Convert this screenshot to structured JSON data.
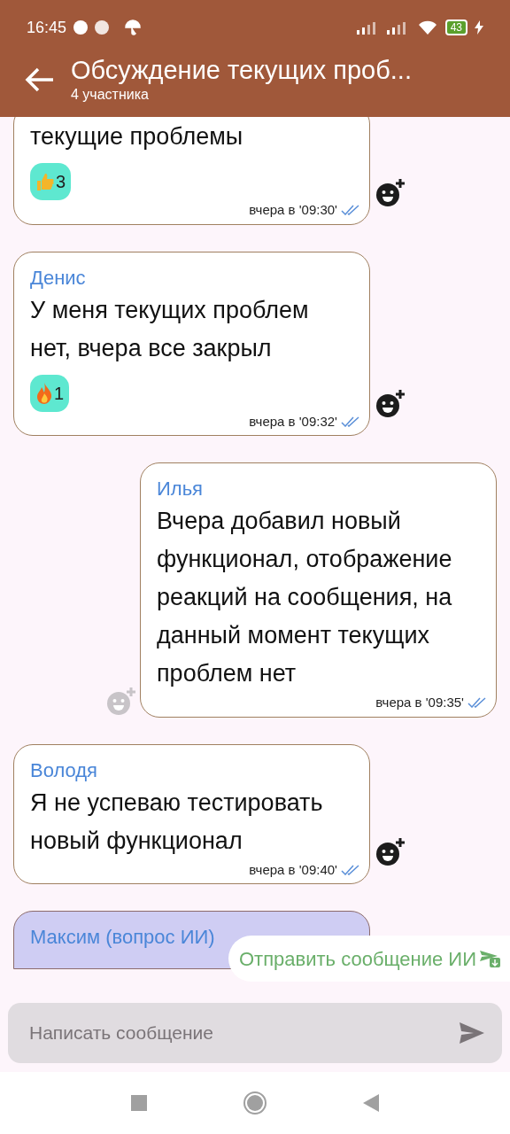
{
  "status_bar": {
    "time": "16:45",
    "battery": "43"
  },
  "header": {
    "title": "Обсуждение текущих проб...",
    "subtitle": "4 участника"
  },
  "messages": [
    {
      "kind": "normal",
      "outgoing": false,
      "lines": "текущие проблемы",
      "reactions": [
        {
          "kind": "thumbs_up",
          "count": "3"
        }
      ],
      "time": "вчера в '09:30'",
      "read": true
    },
    {
      "kind": "normal",
      "outgoing": false,
      "sender": "Денис",
      "lines": "У меня текущих проблем нет, вчера все закрыл",
      "reactions": [
        {
          "kind": "fire",
          "count": "1"
        }
      ],
      "time": "вчера в '09:32'",
      "read": true
    },
    {
      "kind": "normal",
      "outgoing": true,
      "sender": "Илья",
      "lines": "Вчера добавил новый функционал, отображение реакций на сообщения, на данный момент текущих проблем нет",
      "time": "вчера в '09:35'",
      "read": true
    },
    {
      "kind": "normal",
      "outgoing": false,
      "sender": "Володя",
      "lines": "Я не успеваю тестировать новый функционал",
      "time": "вчера в '09:40'",
      "read": true
    },
    {
      "kind": "ai_question",
      "outgoing": false,
      "sender": "Максим (вопрос ИИ)"
    }
  ],
  "ai_button": {
    "label": "Отправить сообщение ИИ"
  },
  "composer": {
    "placeholder": "Написать сообщение"
  }
}
